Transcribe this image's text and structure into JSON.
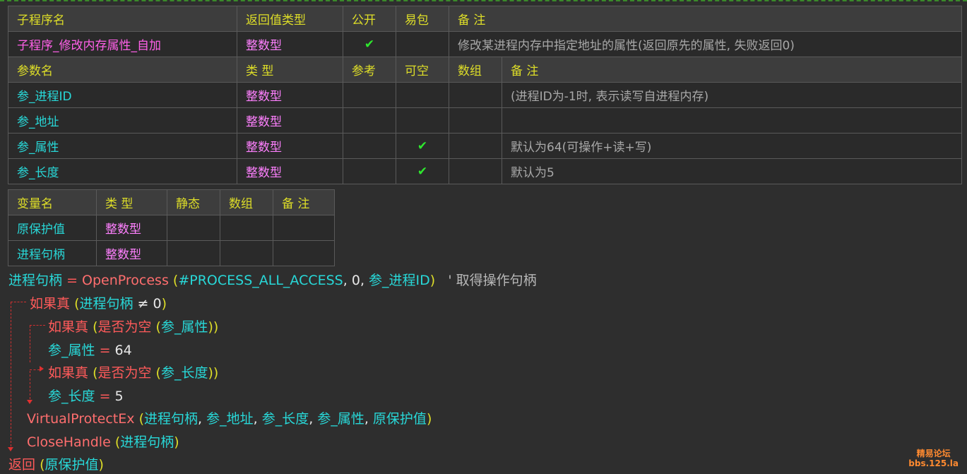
{
  "sub_table": {
    "headers": [
      "子程序名",
      "返回值类型",
      "公开",
      "易包",
      "备 注"
    ],
    "name": "子程序_修改内存属性_自加",
    "return_type": "整数型",
    "public_mark": "✔",
    "remark": "修改某进程内存中指定地址的属性(返回原先的属性, 失败返回0)",
    "param_headers": [
      "参数名",
      "类 型",
      "参考",
      "可空",
      "数组",
      "备 注"
    ],
    "params": [
      {
        "name": "参_进程ID",
        "type": "整数型",
        "ref": "",
        "nullable": "",
        "array": "",
        "remark": "(进程ID为-1时, 表示读写自进程内存)"
      },
      {
        "name": "参_地址",
        "type": "整数型",
        "ref": "",
        "nullable": "",
        "array": "",
        "remark": ""
      },
      {
        "name": "参_属性",
        "type": "整数型",
        "ref": "",
        "nullable": "✔",
        "array": "",
        "remark": "默认为64(可操作+读+写)"
      },
      {
        "name": "参_长度",
        "type": "整数型",
        "ref": "",
        "nullable": "✔",
        "array": "",
        "remark": "默认为5"
      }
    ]
  },
  "var_table": {
    "headers": [
      "变量名",
      "类 型",
      "静态",
      "数组",
      "备 注"
    ],
    "vars": [
      {
        "name": "原保护值",
        "type": "整数型"
      },
      {
        "name": "进程句柄",
        "type": "整数型"
      }
    ]
  },
  "code": {
    "l1_var": "进程句柄",
    "l1_eq": "=",
    "l1_fn": "OpenProcess",
    "l1_open": "(",
    "l1_const": "#PROCESS_ALL_ACCESS",
    "l1_sep1": ",",
    "l1_zero": "0",
    "l1_sep2": ",",
    "l1_arg": "参_进程ID",
    "l1_close": ")",
    "l1_comment": "' 取得操作句柄",
    "l2_kw": "如果真",
    "l2_open": "(",
    "l2_var": "进程句柄",
    "l2_op": "≠",
    "l2_zero": "0",
    "l2_close": ")",
    "l3_kw": "如果真",
    "l3_open": "(",
    "l3_fn": "是否为空",
    "l3_inner_open": "(",
    "l3_arg": "参_属性",
    "l3_close": "))",
    "l4_var": "参_属性",
    "l4_eq": "=",
    "l4_val": "64",
    "l5_kw": "如果真",
    "l5_open": "(",
    "l5_fn": "是否为空",
    "l5_inner_open": "(",
    "l5_arg": "参_长度",
    "l5_close": "))",
    "l6_var": "参_长度",
    "l6_eq": "=",
    "l6_val": "5",
    "l7_fn": "VirtualProtectEx",
    "l7_open": "(",
    "l7_args": [
      "进程句柄",
      "参_地址",
      "参_长度",
      "参_属性",
      "原保护值"
    ],
    "l7_sep": ",",
    "l7_close": ")",
    "l8_fn": "CloseHandle",
    "l8_open": "(",
    "l8_arg": "进程句柄",
    "l8_close": ")",
    "l9_kw": "返回",
    "l9_open": "(",
    "l9_arg": "原保护值",
    "l9_close": ")"
  },
  "watermark": {
    "line1": "精易论坛",
    "line2": "bbs.125.la"
  }
}
